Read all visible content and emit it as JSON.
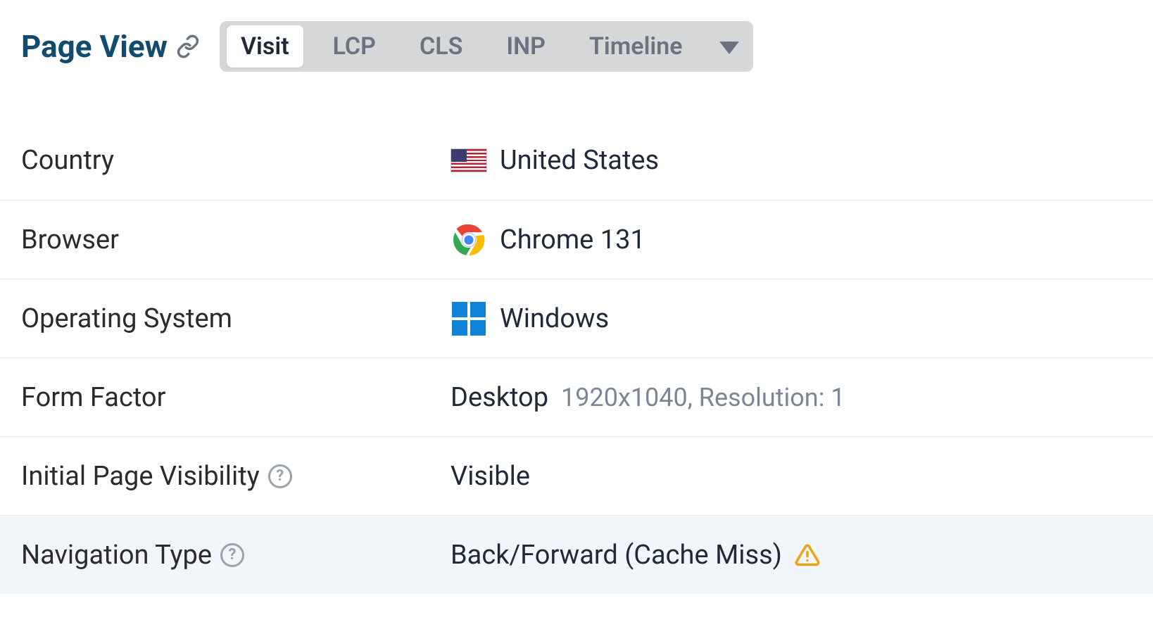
{
  "header": {
    "title": "Page View",
    "tabs": [
      "Visit",
      "LCP",
      "CLS",
      "INP",
      "Timeline"
    ],
    "active_tab_index": 0
  },
  "rows": {
    "country": {
      "label": "Country",
      "value": "United States",
      "icon": "flag-us-icon"
    },
    "browser": {
      "label": "Browser",
      "value": "Chrome 131",
      "icon": "chrome-icon"
    },
    "os": {
      "label": "Operating System",
      "value": "Windows",
      "icon": "windows-icon"
    },
    "form_factor": {
      "label": "Form Factor",
      "value": "Desktop",
      "secondary": "1920x1040, Resolution: 1"
    },
    "visibility": {
      "label": "Initial Page Visibility",
      "value": "Visible",
      "help": true
    },
    "nav_type": {
      "label": "Navigation Type",
      "value": "Back/Forward (Cache Miss)",
      "help": true,
      "warn": true
    }
  }
}
